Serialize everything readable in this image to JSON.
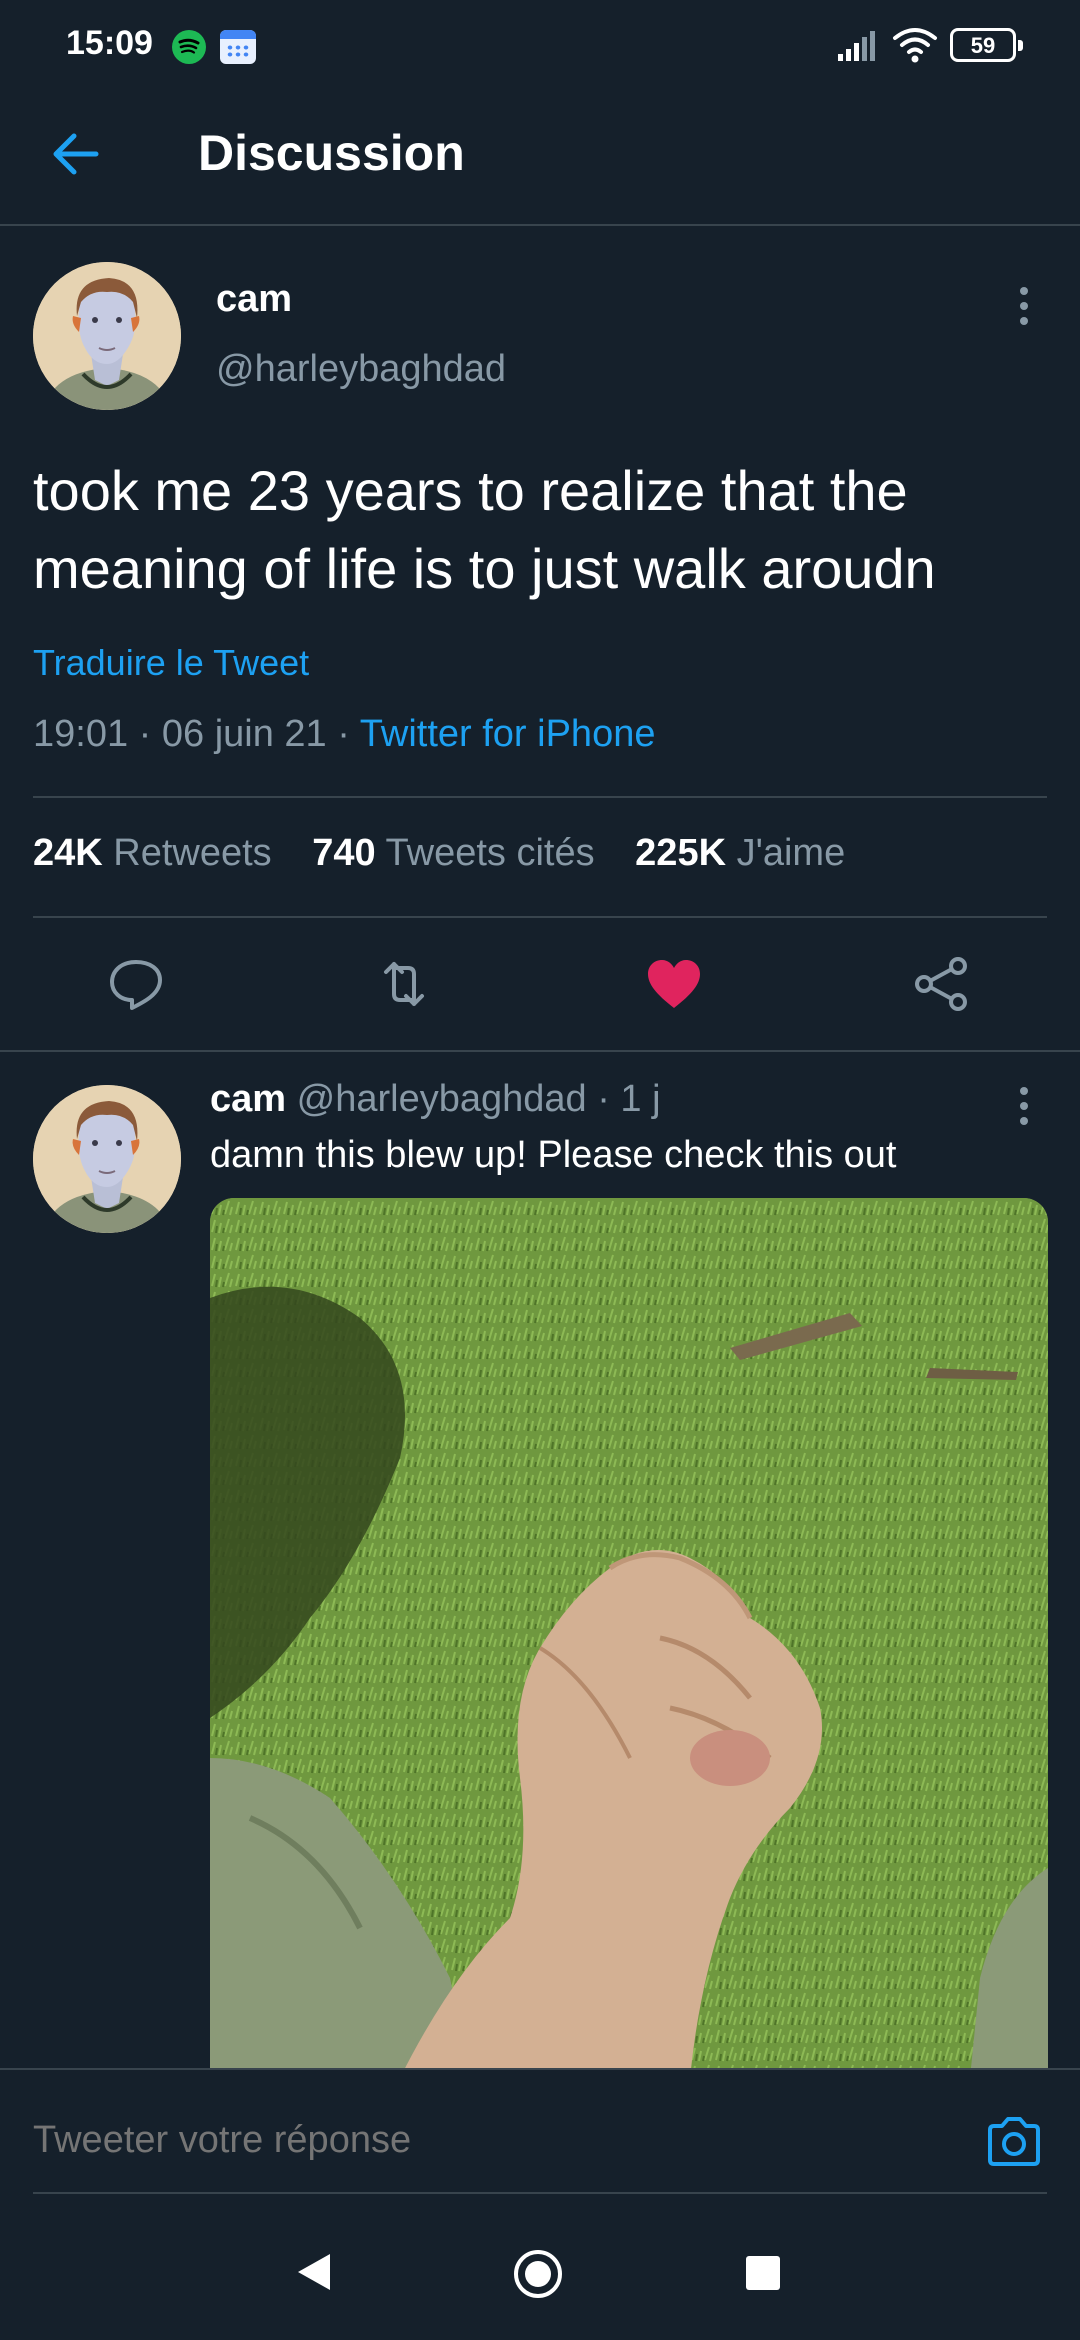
{
  "status_bar": {
    "time": "15:09",
    "battery": "59",
    "icons": [
      "spotify-icon",
      "calendar-icon",
      "signal-icon",
      "wifi-icon",
      "battery-icon"
    ]
  },
  "header": {
    "title": "Discussion",
    "back_icon": "arrow-left-icon"
  },
  "main_tweet": {
    "name": "cam",
    "handle": "@harleybaghdad",
    "text": "took me 23 years to realize that the meaning of life is to just walk aroudn",
    "translate_label": "Traduire le Tweet",
    "time": "19:01",
    "date": "06 juin 21",
    "separator": "·",
    "source": "Twitter for iPhone",
    "stats": {
      "retweets_count": "24K",
      "retweets_label": "Retweets",
      "quotes_count": "740",
      "quotes_label": "Tweets cités",
      "likes_count": "225K",
      "likes_label": "J'aime"
    },
    "actions": [
      "reply-icon",
      "retweet-icon",
      "heart-icon",
      "share-icon"
    ],
    "liked": true
  },
  "reply_tweet": {
    "name": "cam",
    "handle": "@harleybaghdad",
    "time_ago": "· 1 j",
    "text": "damn this blew up! Please check this out"
  },
  "reply_bar": {
    "placeholder": "Tweeter votre réponse"
  },
  "colors": {
    "background": "#15202b",
    "accent": "#1da1f2",
    "like": "#e0245e",
    "secondary_text": "#8899a6",
    "divider": "#38444d"
  }
}
